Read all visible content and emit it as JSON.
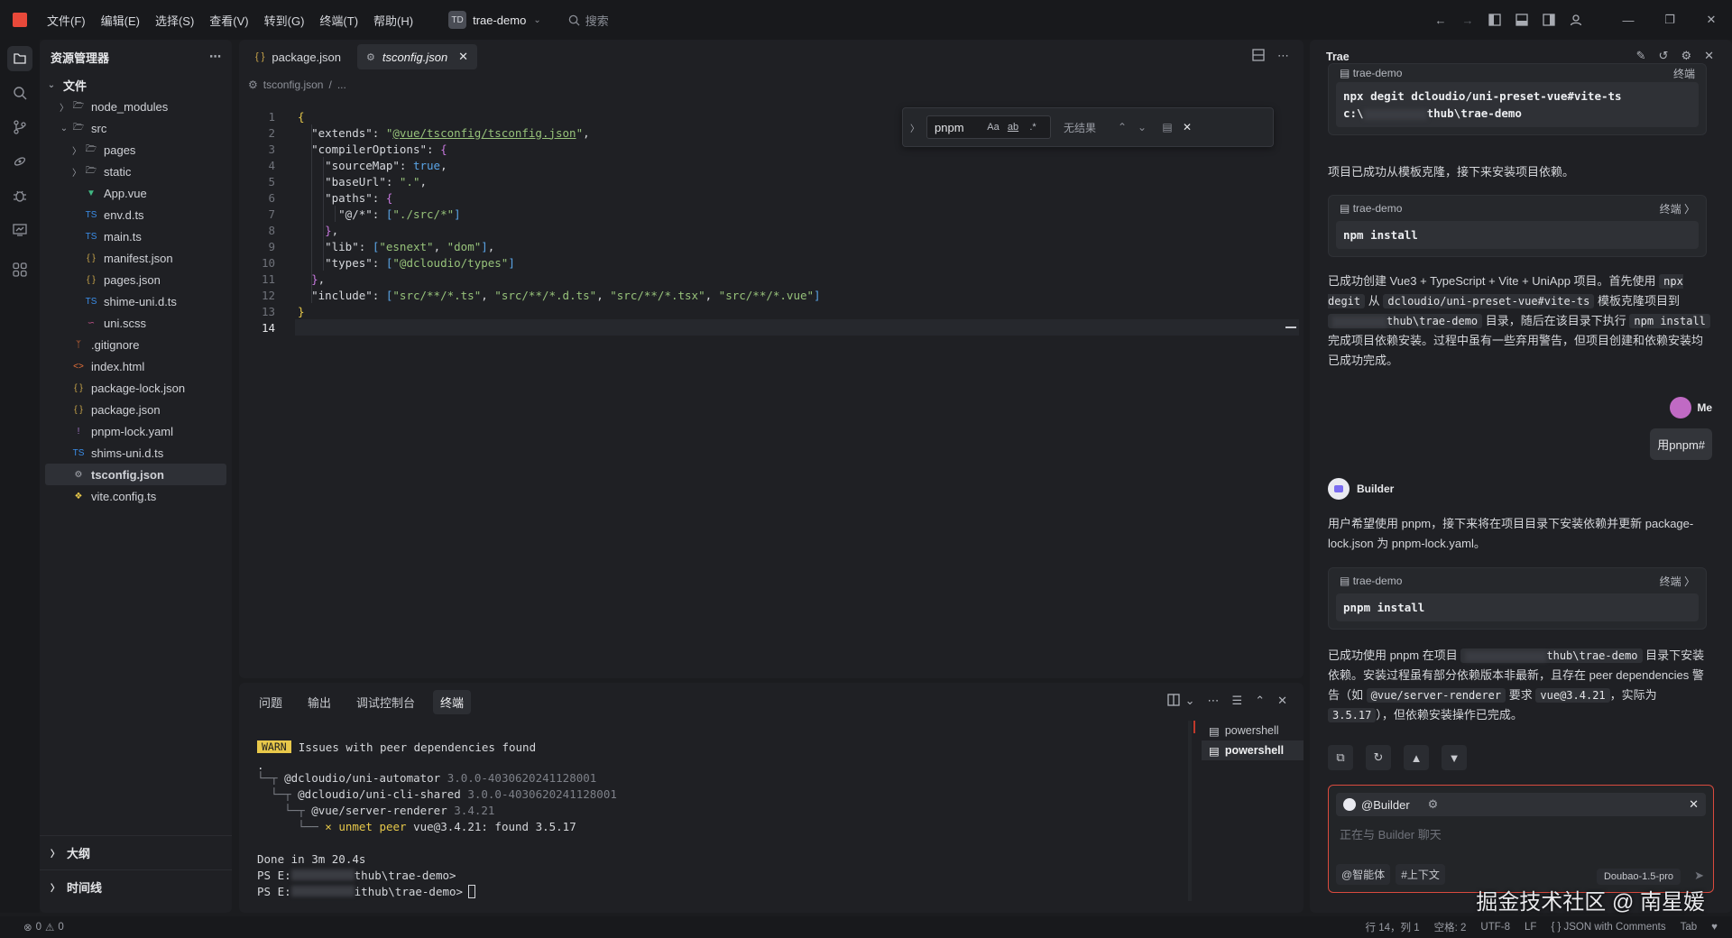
{
  "menu": [
    "文件(F)",
    "编辑(E)",
    "选择(S)",
    "查看(V)",
    "转到(G)",
    "终端(T)",
    "帮助(H)"
  ],
  "project": {
    "badge": "TD",
    "name": "trae-demo"
  },
  "search_placeholder": "搜索",
  "explorer": {
    "title": "资源管理器",
    "root": "文件",
    "items": [
      {
        "label": "node_modules",
        "depth": 1,
        "kind": "folder",
        "expanded": false
      },
      {
        "label": "src",
        "depth": 1,
        "kind": "folder",
        "expanded": true
      },
      {
        "label": "pages",
        "depth": 2,
        "kind": "folder",
        "expanded": false
      },
      {
        "label": "static",
        "depth": 2,
        "kind": "folder",
        "expanded": false
      },
      {
        "label": "App.vue",
        "depth": 2,
        "kind": "vue"
      },
      {
        "label": "env.d.ts",
        "depth": 2,
        "kind": "ts"
      },
      {
        "label": "main.ts",
        "depth": 2,
        "kind": "ts"
      },
      {
        "label": "manifest.json",
        "depth": 2,
        "kind": "json"
      },
      {
        "label": "pages.json",
        "depth": 2,
        "kind": "json"
      },
      {
        "label": "shime-uni.d.ts",
        "depth": 2,
        "kind": "ts"
      },
      {
        "label": "uni.scss",
        "depth": 2,
        "kind": "scss"
      },
      {
        "label": ".gitignore",
        "depth": 1,
        "kind": "git"
      },
      {
        "label": "index.html",
        "depth": 1,
        "kind": "html"
      },
      {
        "label": "package-lock.json",
        "depth": 1,
        "kind": "json"
      },
      {
        "label": "package.json",
        "depth": 1,
        "kind": "json"
      },
      {
        "label": "pnpm-lock.yaml",
        "depth": 1,
        "kind": "yaml"
      },
      {
        "label": "shims-uni.d.ts",
        "depth": 1,
        "kind": "ts"
      },
      {
        "label": "tsconfig.json",
        "depth": 1,
        "kind": "gear",
        "selected": true
      },
      {
        "label": "vite.config.ts",
        "depth": 1,
        "kind": "vite"
      }
    ],
    "sections": [
      "大纲",
      "时间线"
    ]
  },
  "editor": {
    "tabs": [
      {
        "label": "package.json",
        "active": false
      },
      {
        "label": "tsconfig.json",
        "active": true
      }
    ],
    "breadcrumb": [
      "tsconfig.json",
      "..."
    ],
    "current_line": 14,
    "lines": [
      "{",
      "  \"extends\": \"@vue/tsconfig/tsconfig.json\",",
      "  \"compilerOptions\": {",
      "    \"sourceMap\": true,",
      "    \"baseUrl\": \".\",",
      "    \"paths\": {",
      "      \"@/*\": [\"./src/*\"]",
      "    },",
      "    \"lib\": [\"esnext\", \"dom\"],",
      "    \"types\": [\"@dcloudio/types\"]",
      "  },",
      "  \"include\": [\"src/**/*.ts\", \"src/**/*.d.ts\", \"src/**/*.tsx\", \"src/**/*.vue\"]",
      "}",
      ""
    ],
    "find": {
      "query": "pnpm",
      "result": "无结果",
      "opt_case": "Aa",
      "opt_word": "ab",
      "opt_regex": ".*"
    }
  },
  "panel": {
    "tabs": [
      "问题",
      "输出",
      "调试控制台",
      "终端"
    ],
    "active_tab": "终端",
    "terminals": [
      "powershell",
      "powershell"
    ],
    "lines": {
      "warn_badge": "WARN",
      "warn_text": "Issues with peer dependencies found",
      "tree_root": ".",
      "dep1": "@dcloudio/uni-automator",
      "dep1_ver": "3.0.0-4030620241128001",
      "dep2": "@dcloudio/uni-cli-shared",
      "dep2_ver": "3.0.0-4030620241128001",
      "dep3": "@vue/server-renderer",
      "dep3_ver": "3.4.21",
      "unmet_prefix": "× unmet peer",
      "unmet_text": "vue@3.4.21: found 3.5.17",
      "done": "Done in 3m 20.4s",
      "prompt1_a": "PS E:",
      "prompt1_b": "thub\\trae-demo>",
      "prompt2_a": "PS E:",
      "prompt2_b": "ithub\\trae-demo>"
    }
  },
  "chat": {
    "title": "Trae",
    "card0": {
      "project": "trae-demo",
      "label": "终端",
      "cmd": "npx degit dcloudio/uni-preset-vue#vite-ts",
      "cmd2_tail": "thub\\trae-demo"
    },
    "msg1": "项目已成功从模板克隆，接下来安装项目依赖。",
    "card1": {
      "project": "trae-demo",
      "label": "终端",
      "cmd": "npm install"
    },
    "summary": {
      "p1": "已成功创建 Vue3 + TypeScript + Vite + UniApp 项目。首先使用",
      "c1": "npx degit",
      "p2": "从",
      "c2": "dcloudio/uni-preset-vue#vite-ts",
      "p3": "模板克隆项目到",
      "c3": "thub\\trae-demo",
      "p4": "目录，随后在该目录下执行",
      "c4": "npm install",
      "p5": "完成项目依赖安装。过程中虽有一些弃用警告，但项目创建和依赖安装均已成功完成。"
    },
    "me_name": "Me",
    "me_message": "用pnpm#",
    "builder_name": "Builder",
    "msg2": "用户希望使用 pnpm，接下来将在项目目录下安装依赖并更新 package-lock.json 为 pnpm-lock.yaml。",
    "card2": {
      "project": "trae-demo",
      "label": "终端",
      "cmd": "pnpm install"
    },
    "final": {
      "p1": "已成功使用 pnpm 在项目",
      "c1": "thub\\trae-demo",
      "p2": "目录下安装依赖。安装过程虽有部分依赖版本非最新，且存在 peer dependencies 警告（如",
      "c2": "@vue/server-renderer",
      "p3": "要求",
      "c3": "vue@3.4.21",
      "p4": "，实际为",
      "c4": "3.5.17",
      "p5": "），但依赖安装操作已完成。"
    },
    "input": {
      "mention": "@Builder",
      "placeholder": "正在与 Builder 聊天",
      "chip1": "@智能体",
      "chip2": "#上下文",
      "model": "Doubao-1.5-pro"
    }
  },
  "watermark": "掘金技术社区 @ 南星媛",
  "status": {
    "errors": "0",
    "warnings": "0",
    "position": "行 14，列 1",
    "indent": "空格: 2",
    "encoding": "UTF-8",
    "eol": "LF",
    "language": "JSON with Comments",
    "tab_label": "Tab"
  }
}
